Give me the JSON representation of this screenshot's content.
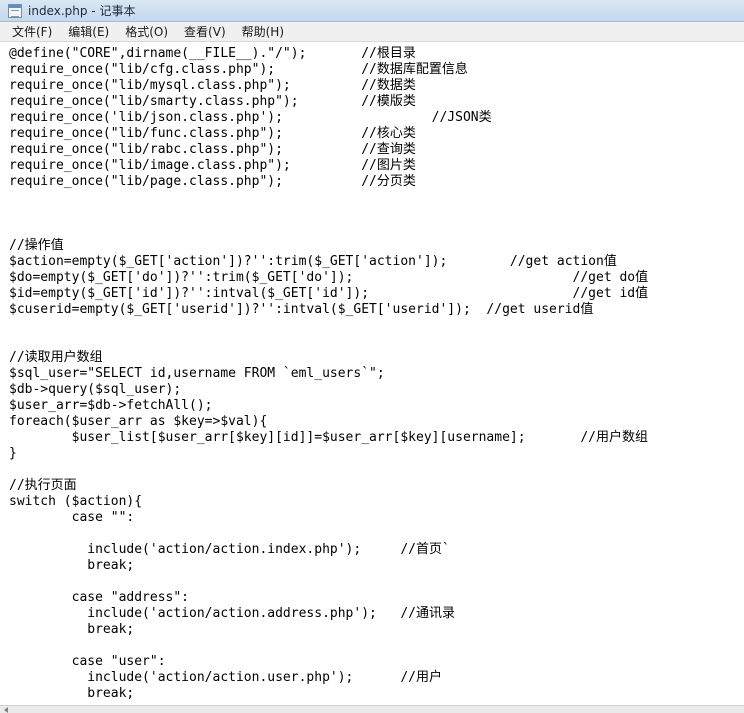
{
  "window": {
    "title": "index.php - 记事本"
  },
  "menu": [
    {
      "label": "文件(F)"
    },
    {
      "label": "编辑(E)"
    },
    {
      "label": "格式(O)"
    },
    {
      "label": "查看(V)"
    },
    {
      "label": "帮助(H)"
    }
  ],
  "editor": {
    "lines": [
      "@define(\"CORE\",dirname(__FILE__).\"/\");       //根目录",
      "require_once(\"lib/cfg.class.php\");           //数据库配置信息",
      "require_once(\"lib/mysql.class.php\");         //数据类",
      "require_once(\"lib/smarty.class.php\");        //模版类",
      "require_once('lib/json.class.php');                   //JSON类",
      "require_once(\"lib/func.class.php\");          //核心类",
      "require_once(\"lib/rabc.class.php\");          //查询类",
      "require_once(\"lib/image.class.php\");         //图片类",
      "require_once(\"lib/page.class.php\");          //分页类",
      "",
      "",
      "",
      "//操作值",
      "$action=empty($_GET['action'])?'':trim($_GET['action']);        //get action值",
      "$do=empty($_GET['do'])?'':trim($_GET['do']);                            //get do值",
      "$id=empty($_GET['id'])?'':intval($_GET['id']);                          //get id值",
      "$cuserid=empty($_GET['userid'])?'':intval($_GET['userid']);  //get userid值",
      "",
      "",
      "//读取用户数组",
      "$sql_user=\"SELECT id,username FROM `eml_users`\";",
      "$db->query($sql_user);",
      "$user_arr=$db->fetchAll();",
      "foreach($user_arr as $key=>$val){",
      "        $user_list[$user_arr[$key][id]]=$user_arr[$key][username];       //用户数组",
      "}",
      "",
      "//执行页面",
      "switch ($action){",
      "        case \"\":",
      "",
      "          include('action/action.index.php');     //首页`",
      "          break;",
      "",
      "        case \"address\":",
      "          include('action/action.address.php');   //通讯录",
      "          break;",
      "",
      "        case \"user\":",
      "          include('action/action.user.php');      //用户",
      "          break;"
    ]
  }
}
